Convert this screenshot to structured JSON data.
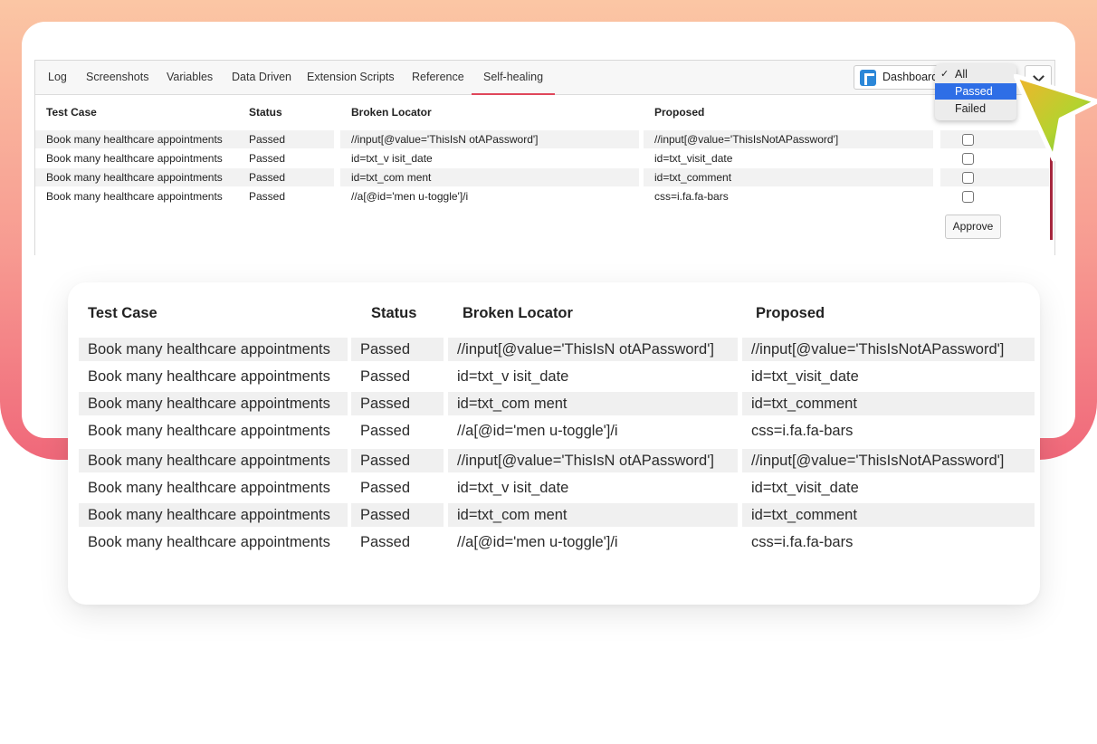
{
  "tabs": [
    "Log",
    "Screenshots",
    "Variables",
    "Data Driven",
    "Extension Scripts",
    "Reference",
    "Self-healing"
  ],
  "active_tab": "Self-healing",
  "dashboard_label": "Dashboard",
  "dropdown": {
    "options": [
      "All",
      "Passed",
      "Failed"
    ],
    "checked": "All",
    "highlighted": "Passed",
    "check_mark": "✓"
  },
  "table": {
    "headers": {
      "test_case": "Test Case",
      "status": "Status",
      "broken_locator": "Broken Locator",
      "proposed": "Proposed"
    },
    "rows": [
      {
        "test_case": "Book many healthcare appointments",
        "status": "Passed",
        "broken_locator": "//input[@value='ThisIsN otAPassword']",
        "proposed": "//input[@value='ThisIsNotAPassword']"
      },
      {
        "test_case": "Book many healthcare appointments",
        "status": "Passed",
        "broken_locator": "id=txt_v isit_date",
        "proposed": "id=txt_visit_date"
      },
      {
        "test_case": "Book many healthcare appointments",
        "status": "Passed",
        "broken_locator": "id=txt_com ment",
        "proposed": "id=txt_comment"
      },
      {
        "test_case": "Book many healthcare appointments",
        "status": "Passed",
        "broken_locator": "//a[@id='men u-toggle']/i",
        "proposed": "css=i.fa.fa-bars"
      }
    ]
  },
  "approve_label": "Approve",
  "zoom_table": {
    "headers": {
      "test_case": "Test Case",
      "status": "Status",
      "broken_locator": "Broken Locator",
      "proposed": "Proposed"
    },
    "rows": [
      {
        "test_case": "Book many healthcare appointments",
        "status": "Passed",
        "broken_locator": "//input[@value='ThisIsN otAPassword']",
        "proposed": "//input[@value='ThisIsNotAPassword']"
      },
      {
        "test_case": "Book many healthcare appointments",
        "status": "Passed",
        "broken_locator": "id=txt_v isit_date",
        "proposed": "id=txt_visit_date"
      },
      {
        "test_case": "Book many healthcare appointments",
        "status": "Passed",
        "broken_locator": "id=txt_com ment",
        "proposed": "id=txt_comment"
      },
      {
        "test_case": "Book many healthcare appointments",
        "status": "Passed",
        "broken_locator": "//a[@id='men u-toggle']/i",
        "proposed": "css=i.fa.fa-bars"
      },
      {
        "test_case": "Book many healthcare appointments",
        "status": "Passed",
        "broken_locator": "//input[@value='ThisIsN otAPassword']",
        "proposed": "//input[@value='ThisIsNotAPassword']"
      },
      {
        "test_case": "Book many healthcare appointments",
        "status": "Passed",
        "broken_locator": "id=txt_v isit_date",
        "proposed": "id=txt_visit_date"
      },
      {
        "test_case": "Book many healthcare appointments",
        "status": "Passed",
        "broken_locator": "id=txt_com ment",
        "proposed": "id=txt_comment"
      },
      {
        "test_case": "Book many healthcare appointments",
        "status": "Passed",
        "broken_locator": "//a[@id='men u-toggle']/i",
        "proposed": "css=i.fa.fa-bars"
      }
    ]
  },
  "colors": {
    "accent": "#e0475b",
    "highlight": "#2e6ee6",
    "gradient_top": "#fbc6a4",
    "gradient_bottom": "#f0687a"
  }
}
